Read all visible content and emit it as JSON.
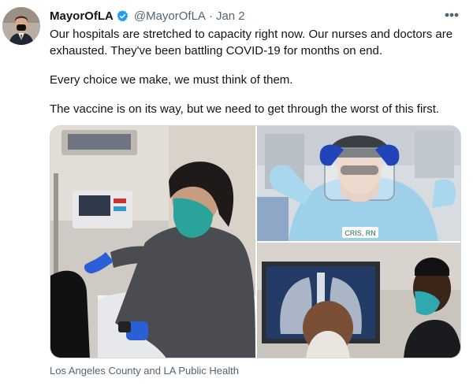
{
  "author": {
    "display_name": "MayorOfLA",
    "handle": "@MayorOfLA",
    "separator": "·",
    "date": "Jan 2",
    "verified": true
  },
  "tweet": {
    "paragraphs": [
      "Our hospitals are stretched to capacity right now. Our nurses and doctors are exhausted. They've been battling COVID-19 for months on end.",
      "Every choice we make, we must think of them.",
      "The vaccine is on its way, but we need to get through the worst of this first."
    ]
  },
  "media": {
    "photos": [
      {
        "icon": "nurse-with-monitor-photo"
      },
      {
        "icon": "health-worker-ppe-photo"
      },
      {
        "icon": "xray-review-photo"
      }
    ],
    "credit": "Los Angeles County and LA Public Health",
    "badge_text": "CRIS, RN"
  },
  "colors": {
    "verified_blue": "#1d9bf0",
    "secondary_text": "#536471",
    "primary_text": "#0f1419"
  }
}
